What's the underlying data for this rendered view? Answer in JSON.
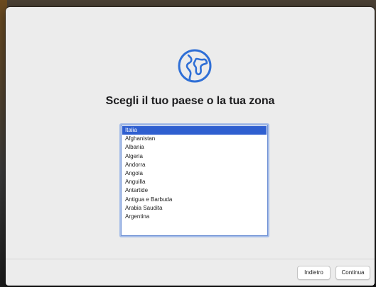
{
  "setup": {
    "title": "Scegli il tuo paese o la tua zona",
    "icon": "globe-icon",
    "countries": [
      "Italia",
      "Afghanistan",
      "Albania",
      "Algeria",
      "Andorra",
      "Angola",
      "Anguilla",
      "Antartide",
      "Antigua e Barbuda",
      "Arabia Saudita",
      "Argentina"
    ],
    "selected": "Italia"
  },
  "footer": {
    "back_label": "Indietro",
    "continue_label": "Continua"
  },
  "colors": {
    "accent": "#2f5fd0",
    "globe_stroke": "#2f6fd6",
    "window_bg": "#ececec"
  }
}
